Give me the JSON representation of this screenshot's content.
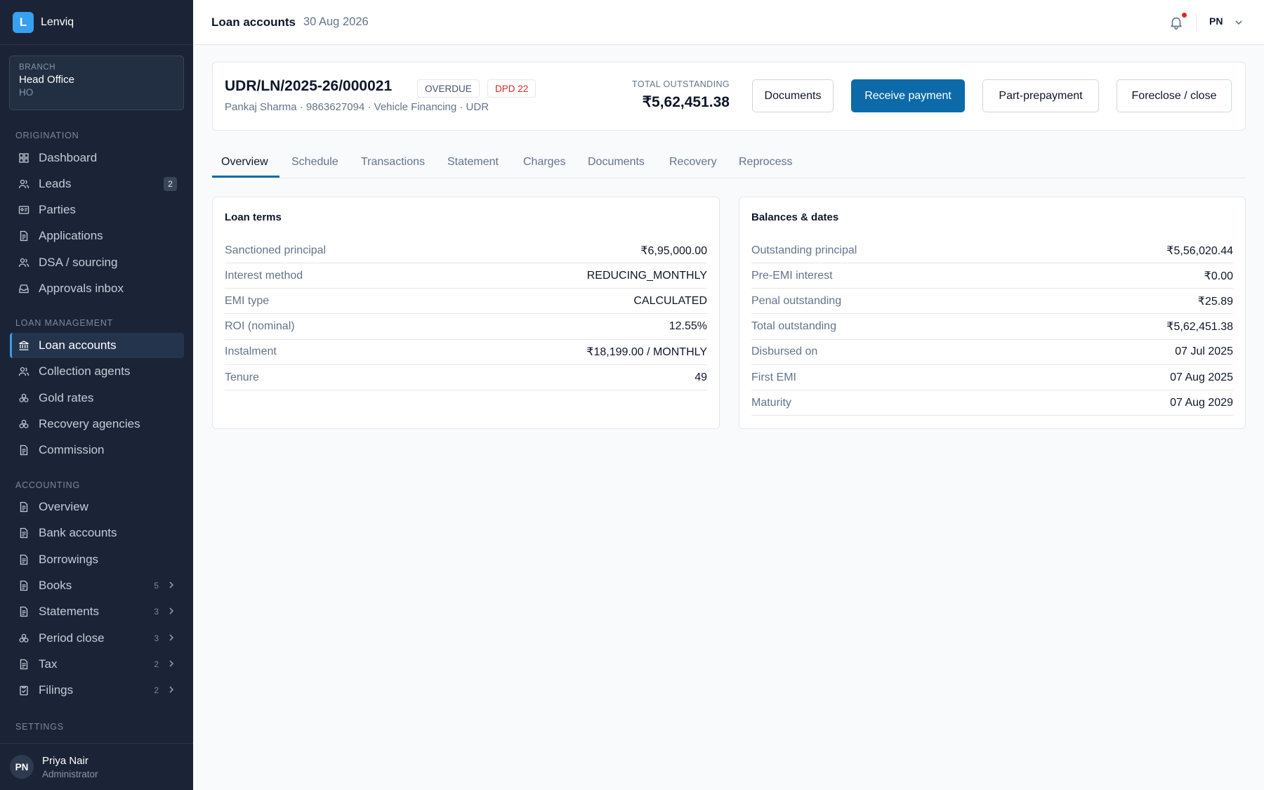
{
  "app": {
    "logo_letter": "L",
    "name": "Lenviq"
  },
  "branch": {
    "label": "BRANCH",
    "name": "Head Office",
    "code": "HO"
  },
  "sidebar": {
    "sections": [
      {
        "title": "ORIGINATION"
      },
      {
        "title": "LOAN MANAGEMENT"
      },
      {
        "title": "ACCOUNTING"
      },
      {
        "title": "SETTINGS"
      }
    ],
    "items": [
      {
        "label": "Dashboard",
        "icon": "grid-icon"
      },
      {
        "label": "Leads",
        "icon": "users-icon",
        "badge": "2"
      },
      {
        "label": "Parties",
        "icon": "id-card-icon"
      },
      {
        "label": "Applications",
        "icon": "document-icon"
      },
      {
        "label": "DSA / sourcing",
        "icon": "users-icon"
      },
      {
        "label": "Approvals inbox",
        "icon": "inbox-icon"
      },
      {
        "label": "Loan accounts",
        "icon": "bank-icon",
        "active": true
      },
      {
        "label": "Collection agents",
        "icon": "users-icon"
      },
      {
        "label": "Gold rates",
        "icon": "coins-icon"
      },
      {
        "label": "Recovery agencies",
        "icon": "coins-icon"
      },
      {
        "label": "Commission",
        "icon": "document-icon"
      },
      {
        "label": "Overview",
        "icon": "document-icon"
      },
      {
        "label": "Bank accounts",
        "icon": "document-icon"
      },
      {
        "label": "Borrowings",
        "icon": "document-icon"
      },
      {
        "label": "Books",
        "icon": "document-icon",
        "count": "5"
      },
      {
        "label": "Statements",
        "icon": "document-icon",
        "count": "3"
      },
      {
        "label": "Period close",
        "icon": "coins-icon",
        "count": "3"
      },
      {
        "label": "Tax",
        "icon": "document-icon",
        "count": "2"
      },
      {
        "label": "Filings",
        "icon": "clipboard-icon",
        "count": "2"
      }
    ]
  },
  "user": {
    "initials": "PN",
    "name": "Priya Nair",
    "role": "Administrator"
  },
  "topbar": {
    "title": "Loan accounts",
    "date": "30 Aug 2026",
    "initials": "PN"
  },
  "loan": {
    "id": "UDR/LN/2025-26/000021",
    "status": "OVERDUE",
    "dpd": "DPD 22",
    "meta": "Pankaj Sharma · 9863627094 · Vehicle Financing · UDR",
    "outstanding_label": "TOTAL OUTSTANDING",
    "outstanding_value": "₹5,62,451.38"
  },
  "actions": {
    "documents": "Documents",
    "receive_payment": "Receive payment",
    "part_prepayment": "Part-prepayment",
    "foreclose": "Foreclose / close"
  },
  "tabs": [
    "Overview",
    "Schedule",
    "Transactions",
    "Statement",
    "Charges",
    "Documents",
    "Recovery",
    "Reprocess"
  ],
  "loan_terms": {
    "title": "Loan terms",
    "rows": [
      {
        "label": "Sanctioned principal",
        "value": "₹6,95,000.00"
      },
      {
        "label": "Interest method",
        "value": "REDUCING_MONTHLY"
      },
      {
        "label": "EMI type",
        "value": "CALCULATED"
      },
      {
        "label": "ROI (nominal)",
        "value": "12.55%"
      },
      {
        "label": "Instalment",
        "value": "₹18,199.00 / MONTHLY"
      },
      {
        "label": "Tenure",
        "value": "49"
      }
    ]
  },
  "balances": {
    "title": "Balances & dates",
    "rows": [
      {
        "label": "Outstanding principal",
        "value": "₹5,56,020.44"
      },
      {
        "label": "Pre-EMI interest",
        "value": "₹0.00"
      },
      {
        "label": "Penal outstanding",
        "value": "₹25.89"
      },
      {
        "label": "Total outstanding",
        "value": "₹5,62,451.38"
      },
      {
        "label": "Disbursed on",
        "value": "07 Jul 2025"
      },
      {
        "label": "First EMI",
        "value": "07 Aug 2025"
      },
      {
        "label": "Maturity",
        "value": "07 Aug 2029"
      }
    ]
  }
}
